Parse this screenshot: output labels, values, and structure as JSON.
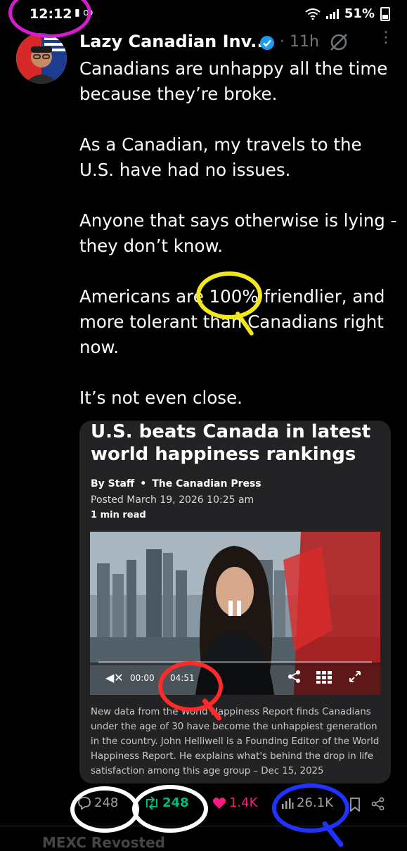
{
  "status_bar": {
    "time": "12:12",
    "left_icons": "▮ ꝏ",
    "signal_icons": "wifi-icon signal-icon",
    "battery": "51%"
  },
  "tweet": {
    "author_name": "Lazy Canadian Inv...",
    "verified": true,
    "time_ago": "11h",
    "dot": "·",
    "paragraphs": [
      "Canadians are unhappy all the time because they’re broke.",
      "As a Canadian, my travels to the U.S. have had no issues.",
      "Anyone that says otherwise is lying - they don’t know.",
      "Americans are 100% friendlier, and more tolerant than Canadians right now.",
      "It’s not even close."
    ]
  },
  "card": {
    "title": "U.S. beats Canada in latest world happiness rankings",
    "byline_author": "By Staff",
    "byline_bullet": "•",
    "byline_outlet": "The Canadian Press",
    "posted": "Posted March 19, 2026 10:25 am",
    "read_time": "1 min read",
    "video": {
      "current_time": "00:00",
      "separator": "/",
      "total_time": "04:51",
      "progress": 0.0
    },
    "description": "New data from the World Happiness Report finds Canadians under the age of 30 have become the unhappiest generation in the country. John Helliwell is a Founding Editor of the World Happiness Report. He explains what's behind the drop in life satisfaction among this age group – Dec 15, 2025"
  },
  "actions": {
    "replies": "248",
    "retweets": "248",
    "likes": "1.4K",
    "views": "26.1K"
  },
  "next_post_peek": "MEXC  Revosted",
  "colors": {
    "background": "#000000",
    "verified": "#1d9bf0",
    "retweet": "#00ba7c",
    "like": "#f91880",
    "annotation_magenta": "#d51cd0",
    "annotation_yellow": "#f4e81b",
    "annotation_red": "#ff2a2a",
    "annotation_white": "#ffffff",
    "annotation_blue": "#1f32ff"
  }
}
